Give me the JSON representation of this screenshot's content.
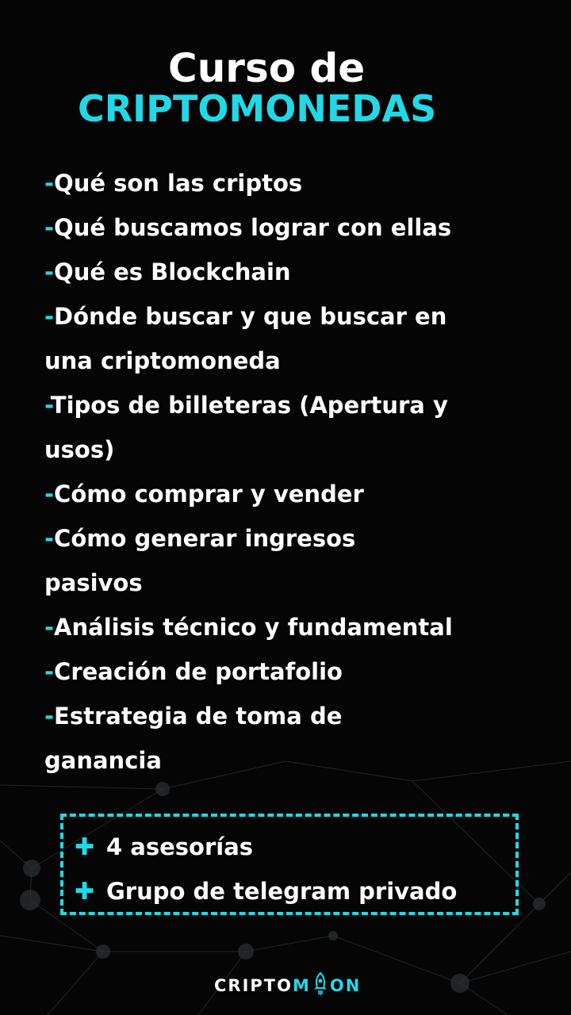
{
  "title": {
    "line1": "Curso de",
    "line2": "CRIPTOMONEDAS"
  },
  "topics": [
    {
      "dash": "-",
      "text": "Qué son las criptos"
    },
    {
      "dash": "-",
      "text": "Qué buscamos lograr con ellas"
    },
    {
      "dash": "-",
      "text": "Qué es Blockchain"
    },
    {
      "dash": "-",
      "text": "Dónde buscar y que buscar en"
    },
    {
      "dash": "",
      "text": "una criptomoneda"
    },
    {
      "dash": "-",
      "text": "Tipos de billeteras (Apertura y"
    },
    {
      "dash": "",
      "text": "usos)"
    },
    {
      "dash": "-",
      "text": "Cómo comprar y vender"
    },
    {
      "dash": "-",
      "text": "Cómo generar ingresos"
    },
    {
      "dash": "",
      "text": "pasivos"
    },
    {
      "dash": "-",
      "text": "Análisis técnico y fundamental"
    },
    {
      "dash": "-",
      "text": "Creación de portafolio"
    },
    {
      "dash": "-",
      "text": "Estrategia de toma de"
    },
    {
      "dash": "",
      "text": "ganancia"
    }
  ],
  "extras": {
    "bullet": "✚",
    "items": [
      "4 asesorías",
      "Grupo de telegram privado"
    ]
  },
  "brand": {
    "prefix": "CRIPTO",
    "m": "M",
    "suffix": "ON",
    "logo_icon": "rocket-icon"
  },
  "colors": {
    "background": "#050505",
    "accent": "#22d8e6",
    "text": "#ffffff"
  }
}
